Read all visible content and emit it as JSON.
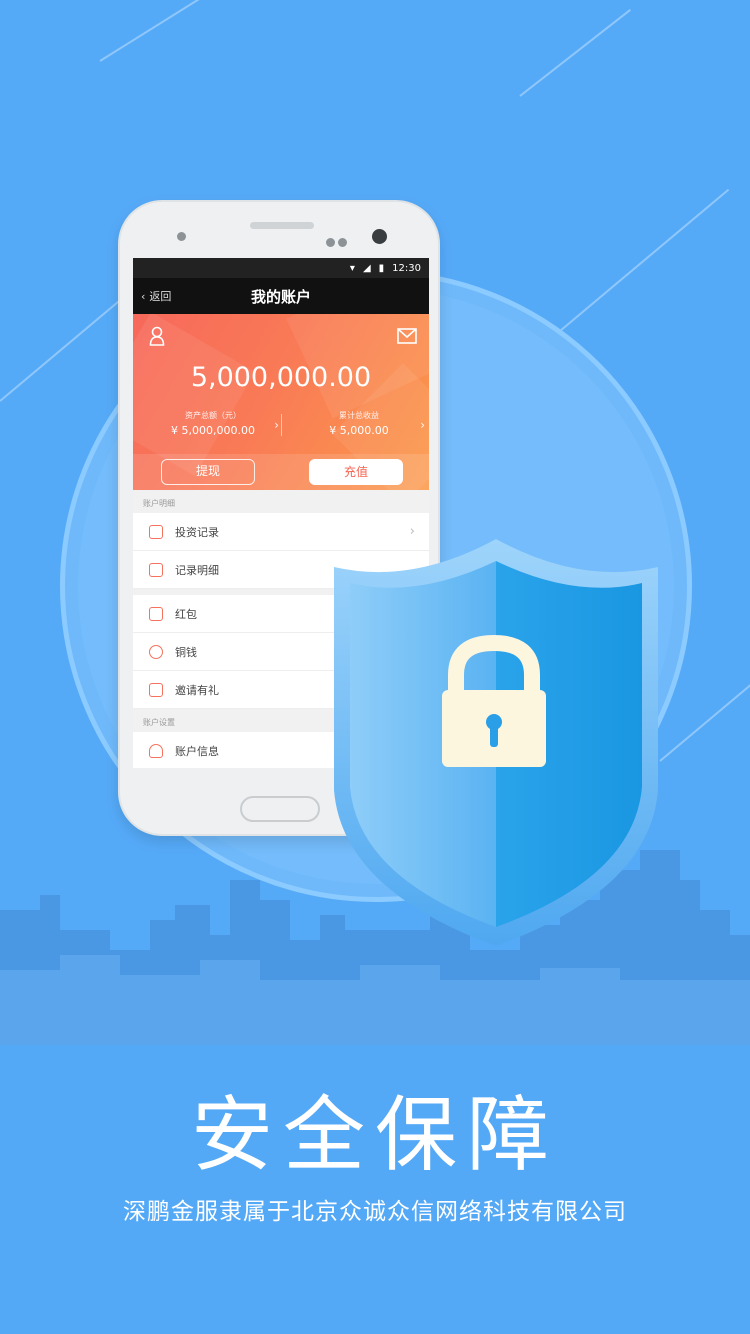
{
  "phone": {
    "status_time": "12:30",
    "nav_back_label": "返回",
    "nav_title": "我的账户",
    "balance": "5,000,000.00",
    "stats": [
      {
        "label": "资产总额（元）",
        "value": "¥ 5,000,000.00"
      },
      {
        "label": "累计总收益",
        "value": "¥ 5,000.00"
      }
    ],
    "withdraw_label": "提现",
    "recharge_label": "充值",
    "section1_title": "账户明细",
    "group1": [
      {
        "label": "投资记录"
      },
      {
        "label": "记录明细"
      }
    ],
    "group2": [
      {
        "label": "红包"
      },
      {
        "label": "铜钱"
      },
      {
        "label": "邀请有礼"
      }
    ],
    "section2_title": "账户设置",
    "group3": [
      {
        "label": "账户信息"
      }
    ]
  },
  "headline": "安全保障",
  "subline": "深鹏金服隶属于北京众诚众信网络科技有限公司",
  "colors": {
    "background": "#55aaf8",
    "accent_orange": "#f7695b",
    "shield_light": "#7cc3f7",
    "shield_dark": "#1e9be6",
    "lock_body": "#fdf6df"
  }
}
